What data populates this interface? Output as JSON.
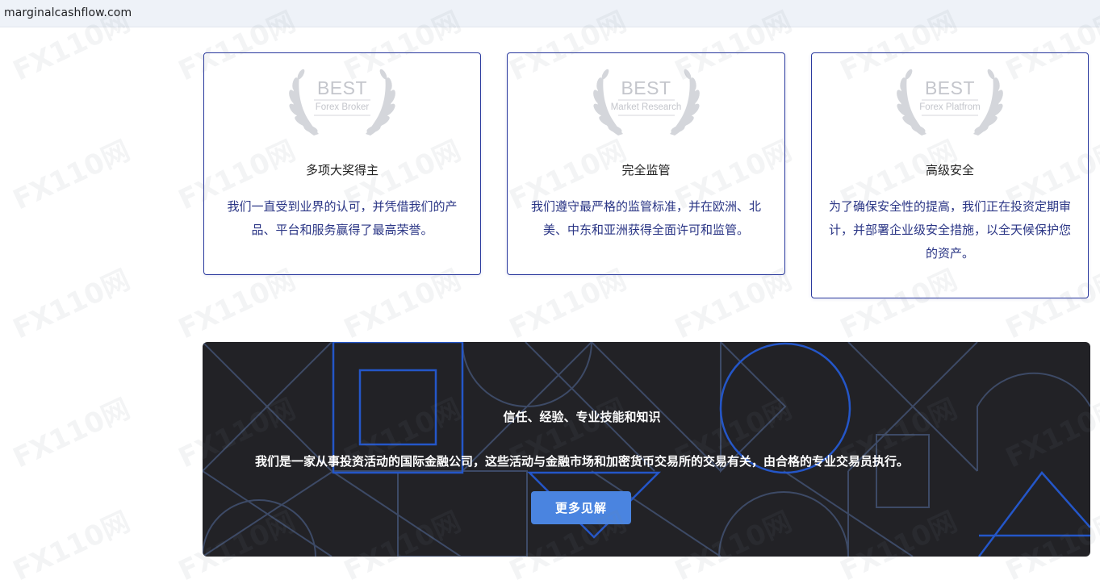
{
  "browser": {
    "url": "marginalcashflow.com"
  },
  "cards": [
    {
      "badge_best": "BEST",
      "badge_sub": "Forex Broker",
      "title": "多项大奖得主",
      "desc": "我们一直受到业界的认可，并凭借我们的产品、平台和服务赢得了最高荣誉。"
    },
    {
      "badge_best": "BEST",
      "badge_sub": "Market Research",
      "title": "完全监管",
      "desc": "我们遵守最严格的监管标准，并在欧洲、北美、中东和亚洲获得全面许可和监管。"
    },
    {
      "badge_best": "BEST",
      "badge_sub": "Forex Platfrom",
      "title": "高级安全",
      "desc": "为了确保安全性的提高，我们正在投资定期审计，并部署企业级安全措施，以全天候保护您的资产。"
    }
  ],
  "banner": {
    "title": "信任、经验、专业技能和知识",
    "text": "我们是一家从事投资活动的国际金融公司，这些活动与金融市场和加密货币交易所的交易有关，由合格的专业交易员执行。",
    "button_label": "更多见解"
  },
  "watermark": {
    "text": "110网"
  },
  "colors": {
    "card_border": "#2b3a9e",
    "desc_text": "#2a3585",
    "banner_bg": "#222226",
    "button_bg": "#4a84e0",
    "pattern_blue": "#2456c8"
  }
}
